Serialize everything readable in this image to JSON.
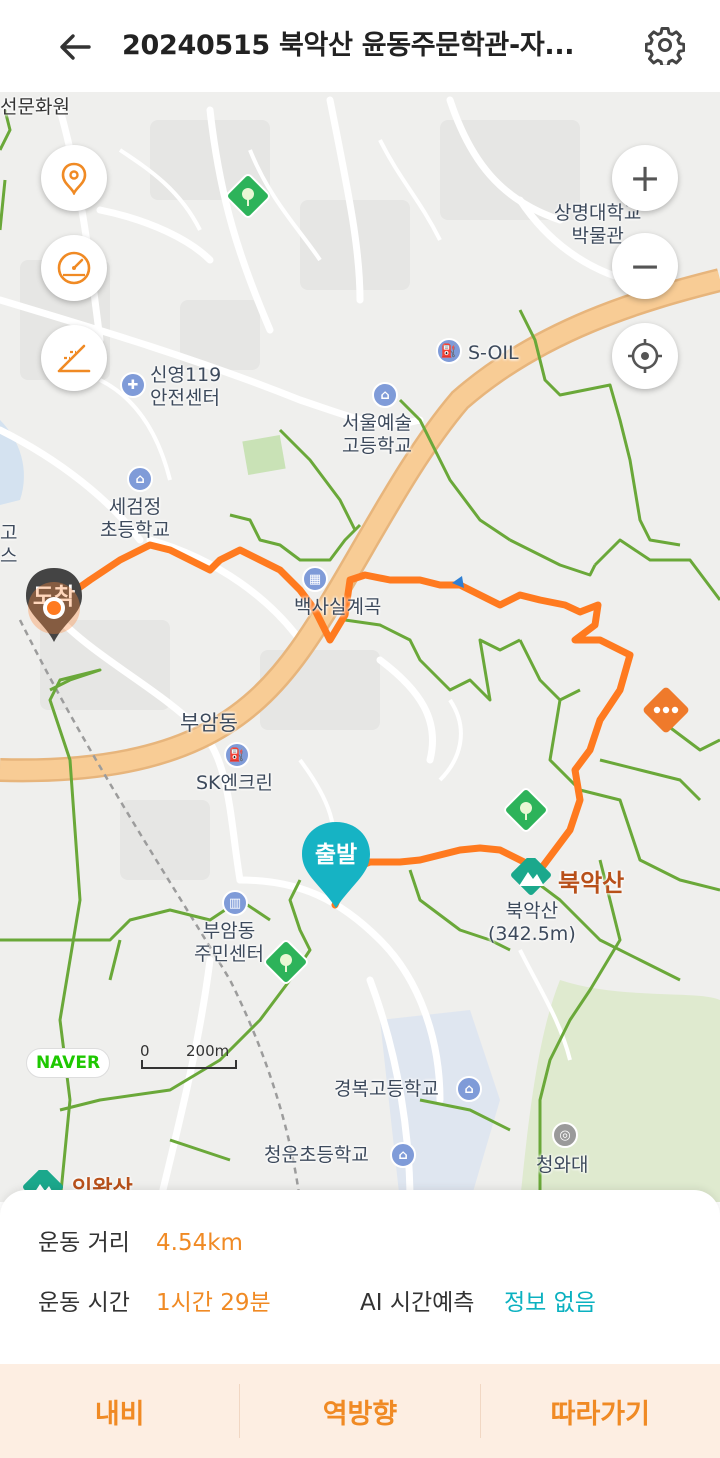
{
  "header": {
    "back_icon": "arrow-left-icon",
    "title": "20240515 북악산 윤동주문학관-자...",
    "settings_icon": "gear-icon"
  },
  "map": {
    "labels": {
      "top_left_cut": "선문화원",
      "fire_station": "신영119\n안전센터",
      "school_segeomjeong": "세검정\n초등학교",
      "school_arts": "서울예술\n고등학교",
      "museum": "상명대학교\n박물관",
      "soil": "S-OIL",
      "baeksa": "백사실계곡",
      "buam": "부암동",
      "sk": "SK엔크린",
      "community": "부암동\n주민센터",
      "mountain": "북악산",
      "mountain_small": "북악산\n(342.5m)",
      "gyeongbok": "경복고등학교",
      "cheongun": "청운초등학교",
      "cheongwadae": "청와대",
      "left_cut": "고\n스",
      "inwangsan_cut": "인왕산"
    },
    "markers": {
      "arrival": "도착",
      "departure": "출발"
    },
    "naver_logo": "NAVER",
    "scale": {
      "zero": "0",
      "distance": "200m"
    },
    "controls": {
      "location_icon": "map-pin-icon",
      "speed_icon": "speedometer-icon",
      "slope_icon": "slope-icon",
      "zoom_in": "+",
      "zoom_out": "−",
      "gps_icon": "crosshair-icon"
    },
    "colors": {
      "route": "#ff7a1f",
      "trail": "#6aa839",
      "road": "#f7c58a",
      "departure_pin": "#16b3c4",
      "arrival_pin": "#444444"
    }
  },
  "stats": {
    "distance_label": "운동 거리",
    "distance_value": "4.54km",
    "time_label": "운동 시간",
    "time_value": "1시간 29분",
    "ai_label": "AI 시간예측",
    "ai_value": "정보 없음"
  },
  "actions": {
    "navi": "내비",
    "reverse": "역방향",
    "follow": "따라가기"
  }
}
